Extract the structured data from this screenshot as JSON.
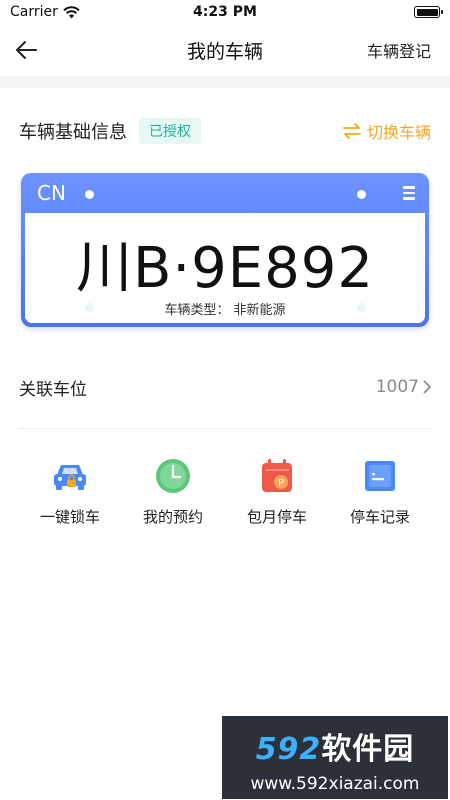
{
  "status_bar": {
    "carrier": "Carrier",
    "time": "4:23 PM"
  },
  "nav": {
    "title": "我的车辆",
    "right_action": "车辆登记"
  },
  "vehicle_section": {
    "title": "车辆基础信息",
    "auth_badge": "已授权",
    "switch_label": "切换车辆"
  },
  "plate": {
    "region": "CN",
    "number": "川B·9E892",
    "type_label": "车辆类型：",
    "type_value": "非新能源",
    "colors": {
      "frame": "#4a73f2",
      "text": "#111111"
    }
  },
  "parking": {
    "label": "关联车位",
    "value": "1007"
  },
  "actions": [
    {
      "label": "一键锁车",
      "icon": "car-lock-icon",
      "color": "#4a8af4"
    },
    {
      "label": "我的预约",
      "icon": "clock-icon",
      "color": "#5cc77a"
    },
    {
      "label": "包月停车",
      "icon": "calendar-parking-icon",
      "color": "#f0594a"
    },
    {
      "label": "停车记录",
      "icon": "record-icon",
      "color": "#4a8af4"
    }
  ],
  "watermark": {
    "brand_num": "592",
    "brand_text": "软件园",
    "url": "www.592xiazai.com"
  },
  "colors": {
    "accent_orange": "#f5a623",
    "badge_green": "#1fb393",
    "badge_bg": "#e6f7f4"
  }
}
